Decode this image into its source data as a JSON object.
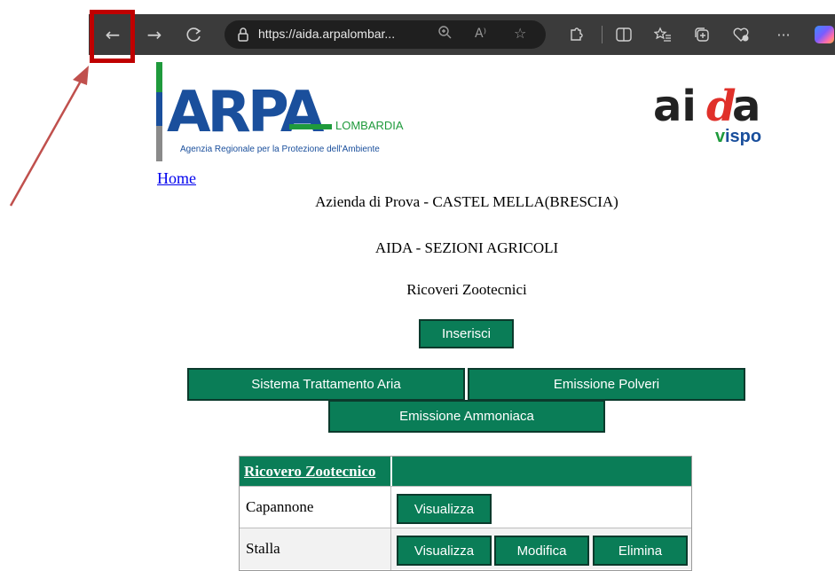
{
  "browser": {
    "url_host": "https://aida.arpalombar...",
    "toolbar_icons": [
      "back-arrow-icon",
      "forward-arrow-icon",
      "refresh-icon",
      "lock-icon",
      "zoom-icon",
      "read-aloud-icon",
      "favorite-star-icon",
      "extensions-icon",
      "split-screen-icon",
      "favorites-list-icon",
      "collections-icon",
      "browser-essentials-icon",
      "more-icon",
      "copilot-icon"
    ],
    "back_arrow": "←",
    "forward_arrow": "→",
    "refresh": "C",
    "more": "···",
    "read_aloud": "A⁾"
  },
  "logos": {
    "arpa_brand": "ARPA",
    "arpa_region": "LOMBARDIA",
    "arpa_tagline": "Agenzia Regionale per la Protezione dell'Ambiente",
    "aida_brand_1": "ai",
    "aida_brand_d": "d",
    "aida_brand_2": "a",
    "aida_sub_1": "v",
    "aida_sub_2": "ispo"
  },
  "nav": {
    "home_link": "Home"
  },
  "page": {
    "company": "Azienda di Prova - CASTEL MELLA(BRESCIA)",
    "section": "AIDA - SEZIONI AGRICOLI",
    "subsection": "Ricoveri Zootecnici"
  },
  "actions": {
    "insert": "Inserisci",
    "air_treatment": "Sistema Trattamento Aria",
    "dust_emission": "Emissione Polveri",
    "ammonia_emission": "Emissione Ammoniaca"
  },
  "table": {
    "header": "Ricovero Zootecnico",
    "rows": [
      {
        "name": "Capannone",
        "view": "Visualizza"
      },
      {
        "name": "Stalla",
        "view": "Visualizza",
        "edit": "Modifica",
        "delete": "Elimina"
      }
    ]
  },
  "colors": {
    "button_green": "#0a7d57",
    "annotation_red": "#c00000",
    "toolbar_bg": "#3b3b3b"
  }
}
